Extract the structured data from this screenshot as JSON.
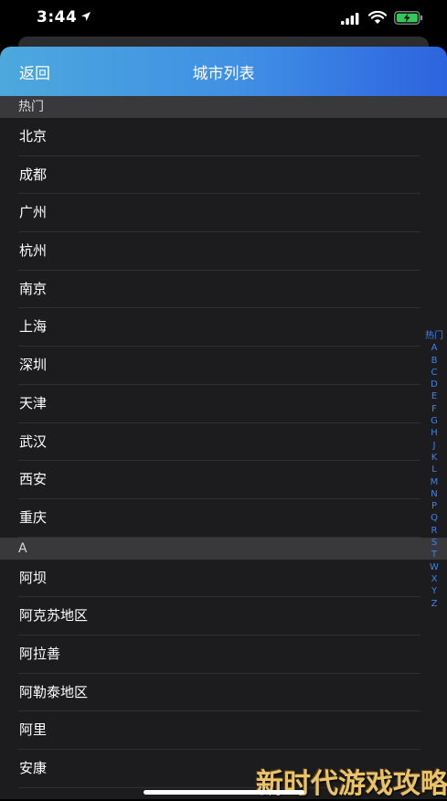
{
  "status_bar": {
    "time": "3:44"
  },
  "nav": {
    "back_label": "返回",
    "title": "城市列表"
  },
  "sections": [
    {
      "header": "热门",
      "items": [
        "北京",
        "成都",
        "广州",
        "杭州",
        "南京",
        "上海",
        "深圳",
        "天津",
        "武汉",
        "西安",
        "重庆"
      ]
    },
    {
      "header": "A",
      "items": [
        "阿坝",
        "阿克苏地区",
        "阿拉善",
        "阿勒泰地区",
        "阿里",
        "安康"
      ]
    }
  ],
  "index_bar": [
    "热门",
    "A",
    "B",
    "C",
    "D",
    "E",
    "F",
    "G",
    "H",
    "J",
    "K",
    "L",
    "M",
    "N",
    "P",
    "Q",
    "R",
    "S",
    "T",
    "W",
    "X",
    "Y",
    "Z"
  ],
  "watermark": "新时代游戏攻略",
  "colors": {
    "accent": "#3b82f6",
    "nav_gradient_start": "#4da8dd",
    "nav_gradient_end": "#2d63e0"
  }
}
